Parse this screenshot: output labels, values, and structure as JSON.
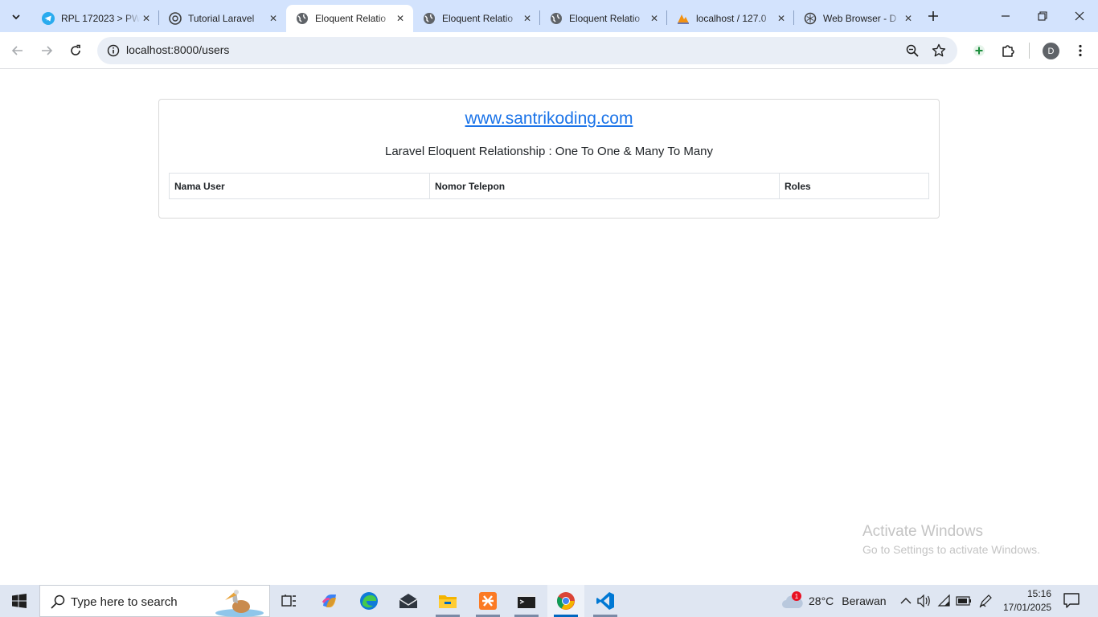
{
  "browser": {
    "tabs": [
      {
        "title": "RPL 172023 > PW",
        "favicon": "telegram-icon",
        "active": false
      },
      {
        "title": "Tutorial Laravel",
        "favicon": "chatgpt-icon",
        "active": false
      },
      {
        "title": "Eloquent Relatio",
        "favicon": "globe-icon",
        "active": true
      },
      {
        "title": "Eloquent Relatio",
        "favicon": "globe-icon",
        "active": false
      },
      {
        "title": "Eloquent Relatio",
        "favicon": "globe-icon",
        "active": false
      },
      {
        "title": "localhost / 127.0",
        "favicon": "phpmyadmin-icon",
        "active": false
      },
      {
        "title": "Web Browser - D",
        "favicon": "openai-icon",
        "active": false
      }
    ],
    "url": "localhost:8000/users",
    "profile_initial": "D"
  },
  "page": {
    "site_link": "www.santrikoding.com",
    "heading": "Laravel Eloquent Relationship : One To One & Many To Many",
    "table": {
      "columns": [
        "Nama User",
        "Nomor Telepon",
        "Roles"
      ],
      "rows": []
    }
  },
  "watermark": {
    "line1": "Activate Windows",
    "line2": "Go to Settings to activate Windows."
  },
  "taskbar": {
    "search_placeholder": "Type here to search",
    "weather_temp": "28°C",
    "weather_desc": "Berawan",
    "weather_badge": "1",
    "time": "15:16",
    "date": "17/01/2025"
  },
  "colors": {
    "tabstrip": "#d3e3fd",
    "link": "#1a73e8",
    "taskbar": "#dfe6f2"
  }
}
